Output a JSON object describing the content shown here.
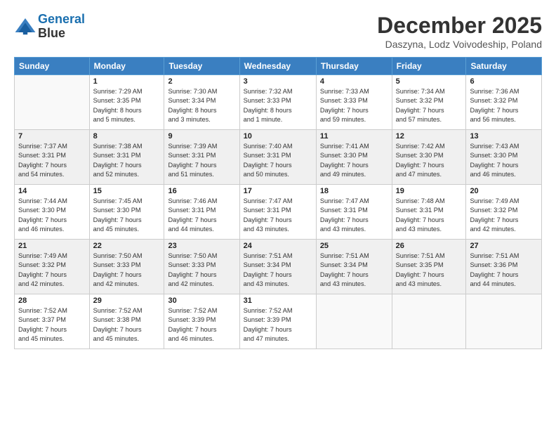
{
  "header": {
    "logo_line1": "General",
    "logo_line2": "Blue",
    "month_title": "December 2025",
    "location": "Daszyna, Lodz Voivodeship, Poland"
  },
  "days_of_week": [
    "Sunday",
    "Monday",
    "Tuesday",
    "Wednesday",
    "Thursday",
    "Friday",
    "Saturday"
  ],
  "weeks": [
    [
      {
        "day": "",
        "info": ""
      },
      {
        "day": "1",
        "info": "Sunrise: 7:29 AM\nSunset: 3:35 PM\nDaylight: 8 hours\nand 5 minutes."
      },
      {
        "day": "2",
        "info": "Sunrise: 7:30 AM\nSunset: 3:34 PM\nDaylight: 8 hours\nand 3 minutes."
      },
      {
        "day": "3",
        "info": "Sunrise: 7:32 AM\nSunset: 3:33 PM\nDaylight: 8 hours\nand 1 minute."
      },
      {
        "day": "4",
        "info": "Sunrise: 7:33 AM\nSunset: 3:33 PM\nDaylight: 7 hours\nand 59 minutes."
      },
      {
        "day": "5",
        "info": "Sunrise: 7:34 AM\nSunset: 3:32 PM\nDaylight: 7 hours\nand 57 minutes."
      },
      {
        "day": "6",
        "info": "Sunrise: 7:36 AM\nSunset: 3:32 PM\nDaylight: 7 hours\nand 56 minutes."
      }
    ],
    [
      {
        "day": "7",
        "info": "Sunrise: 7:37 AM\nSunset: 3:31 PM\nDaylight: 7 hours\nand 54 minutes."
      },
      {
        "day": "8",
        "info": "Sunrise: 7:38 AM\nSunset: 3:31 PM\nDaylight: 7 hours\nand 52 minutes."
      },
      {
        "day": "9",
        "info": "Sunrise: 7:39 AM\nSunset: 3:31 PM\nDaylight: 7 hours\nand 51 minutes."
      },
      {
        "day": "10",
        "info": "Sunrise: 7:40 AM\nSunset: 3:31 PM\nDaylight: 7 hours\nand 50 minutes."
      },
      {
        "day": "11",
        "info": "Sunrise: 7:41 AM\nSunset: 3:30 PM\nDaylight: 7 hours\nand 49 minutes."
      },
      {
        "day": "12",
        "info": "Sunrise: 7:42 AM\nSunset: 3:30 PM\nDaylight: 7 hours\nand 47 minutes."
      },
      {
        "day": "13",
        "info": "Sunrise: 7:43 AM\nSunset: 3:30 PM\nDaylight: 7 hours\nand 46 minutes."
      }
    ],
    [
      {
        "day": "14",
        "info": "Sunrise: 7:44 AM\nSunset: 3:30 PM\nDaylight: 7 hours\nand 46 minutes."
      },
      {
        "day": "15",
        "info": "Sunrise: 7:45 AM\nSunset: 3:30 PM\nDaylight: 7 hours\nand 45 minutes."
      },
      {
        "day": "16",
        "info": "Sunrise: 7:46 AM\nSunset: 3:31 PM\nDaylight: 7 hours\nand 44 minutes."
      },
      {
        "day": "17",
        "info": "Sunrise: 7:47 AM\nSunset: 3:31 PM\nDaylight: 7 hours\nand 43 minutes."
      },
      {
        "day": "18",
        "info": "Sunrise: 7:47 AM\nSunset: 3:31 PM\nDaylight: 7 hours\nand 43 minutes."
      },
      {
        "day": "19",
        "info": "Sunrise: 7:48 AM\nSunset: 3:31 PM\nDaylight: 7 hours\nand 43 minutes."
      },
      {
        "day": "20",
        "info": "Sunrise: 7:49 AM\nSunset: 3:32 PM\nDaylight: 7 hours\nand 42 minutes."
      }
    ],
    [
      {
        "day": "21",
        "info": "Sunrise: 7:49 AM\nSunset: 3:32 PM\nDaylight: 7 hours\nand 42 minutes."
      },
      {
        "day": "22",
        "info": "Sunrise: 7:50 AM\nSunset: 3:33 PM\nDaylight: 7 hours\nand 42 minutes."
      },
      {
        "day": "23",
        "info": "Sunrise: 7:50 AM\nSunset: 3:33 PM\nDaylight: 7 hours\nand 42 minutes."
      },
      {
        "day": "24",
        "info": "Sunrise: 7:51 AM\nSunset: 3:34 PM\nDaylight: 7 hours\nand 43 minutes."
      },
      {
        "day": "25",
        "info": "Sunrise: 7:51 AM\nSunset: 3:34 PM\nDaylight: 7 hours\nand 43 minutes."
      },
      {
        "day": "26",
        "info": "Sunrise: 7:51 AM\nSunset: 3:35 PM\nDaylight: 7 hours\nand 43 minutes."
      },
      {
        "day": "27",
        "info": "Sunrise: 7:51 AM\nSunset: 3:36 PM\nDaylight: 7 hours\nand 44 minutes."
      }
    ],
    [
      {
        "day": "28",
        "info": "Sunrise: 7:52 AM\nSunset: 3:37 PM\nDaylight: 7 hours\nand 45 minutes."
      },
      {
        "day": "29",
        "info": "Sunrise: 7:52 AM\nSunset: 3:38 PM\nDaylight: 7 hours\nand 45 minutes."
      },
      {
        "day": "30",
        "info": "Sunrise: 7:52 AM\nSunset: 3:39 PM\nDaylight: 7 hours\nand 46 minutes."
      },
      {
        "day": "31",
        "info": "Sunrise: 7:52 AM\nSunset: 3:39 PM\nDaylight: 7 hours\nand 47 minutes."
      },
      {
        "day": "",
        "info": ""
      },
      {
        "day": "",
        "info": ""
      },
      {
        "day": "",
        "info": ""
      }
    ]
  ]
}
